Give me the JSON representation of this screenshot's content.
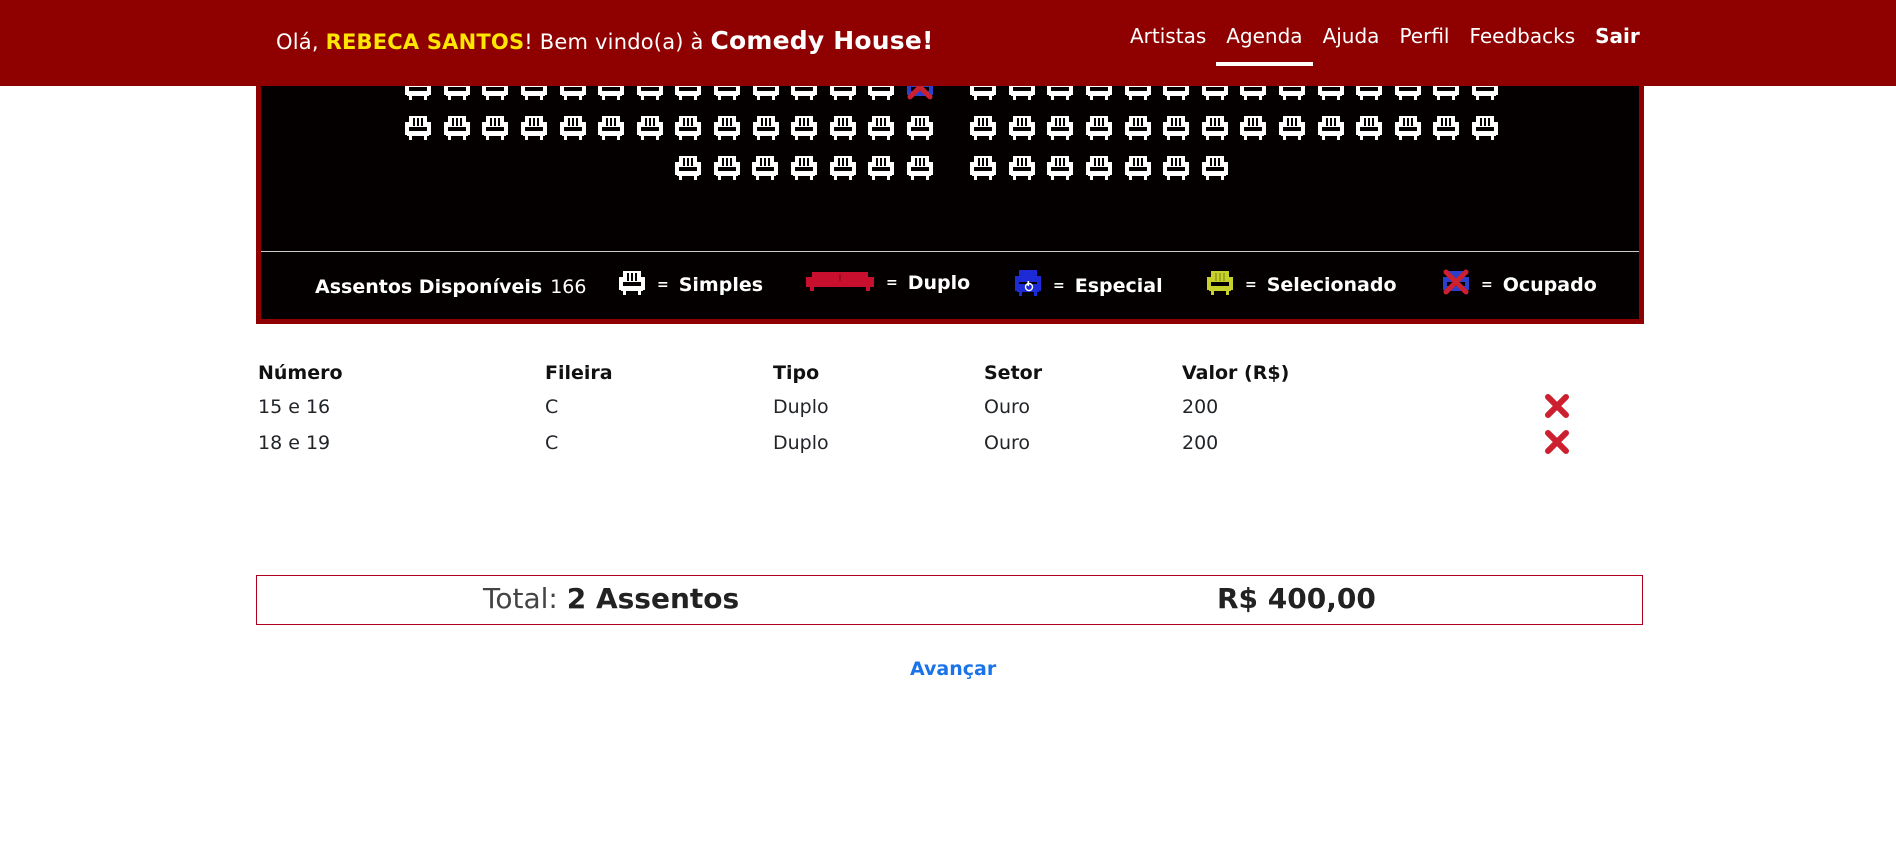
{
  "header": {
    "greeting_prefix": "Olá, ",
    "user_name": "REBECA SANTOS",
    "greeting_middle": "! Bem vindo(a) à ",
    "brand": "Comedy House!",
    "nav": [
      {
        "label": "Artistas"
      },
      {
        "label": "Agenda"
      },
      {
        "label": "Ajuda"
      },
      {
        "label": "Perfil"
      },
      {
        "label": "Feedbacks"
      },
      {
        "label": "Sair"
      }
    ]
  },
  "legend": {
    "available_label": "Assentos Disponíveis",
    "available_count": "166",
    "eq": "=",
    "simple": "Simples",
    "double": "Duplo",
    "special": "Especial",
    "selected": "Selecionado",
    "occupied": "Ocupado"
  },
  "table": {
    "headers": {
      "number": "Número",
      "row": "Fileira",
      "type": "Tipo",
      "sector": "Setor",
      "value": "Valor (R$)"
    },
    "rows": [
      {
        "number": "15 e 16",
        "row": "C",
        "type": "Duplo",
        "sector": "Ouro",
        "value": "200"
      },
      {
        "number": "18 e 19",
        "row": "C",
        "type": "Duplo",
        "sector": "Ouro",
        "value": "200"
      }
    ]
  },
  "total": {
    "label": "Total:",
    "count": "2 Assentos",
    "value": "R$ 400,00"
  },
  "advance_label": "Avançar",
  "colors": {
    "header_bg": "#8f0000",
    "user_name": "#ffe600",
    "seat_simple": "#ffffff",
    "seat_double": "#c8102e",
    "seat_special": "#1d2bd6",
    "seat_selected": "#c7d12c",
    "seat_occupied": "#cc1f2f",
    "link": "#1a73e8"
  }
}
